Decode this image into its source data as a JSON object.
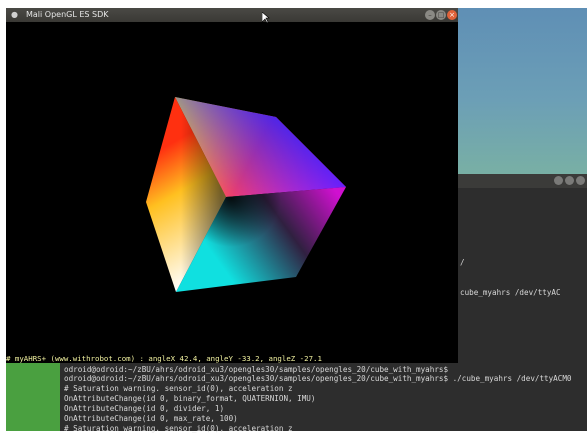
{
  "gl_window": {
    "title": "Mali OpenGL ES SDK",
    "status_line": "# myAHRS+ (www.withrobot.com) : angleX 42.4, angleY -33.2, angleZ -27.1"
  },
  "terminal": {
    "lines": [
      "odroid@odroid:~/zBU/ahrs/odroid_xu3/opengles30/samples/opengles_20/cube_with_myahrs$",
      "odroid@odroid:~/zBU/ahrs/odroid_xu3/opengles30/samples/opengles_20/cube_with_myahrs$ ./cube_myahrs /dev/ttyACM0",
      "# Saturation warning. sensor_id(0), acceleration z",
      "OnAttributeChange(id 0, binary_format, QUATERNION, IMU)",
      "OnAttributeChange(id 0, divider, 1)",
      "OnAttributeChange(id 0, max_rate, 100)",
      "# Saturation warning. sensor_id(0), acceleration z"
    ]
  },
  "background_terminal": {
    "fragments": [
      "/",
      "cube_myahrs /dev/ttyAC"
    ]
  },
  "colors": {
    "terminal_bg": "#2d2d2d",
    "close_button": "#e0623a",
    "launcher_green": "#4aa040",
    "status_text": "#f2f2a0"
  }
}
